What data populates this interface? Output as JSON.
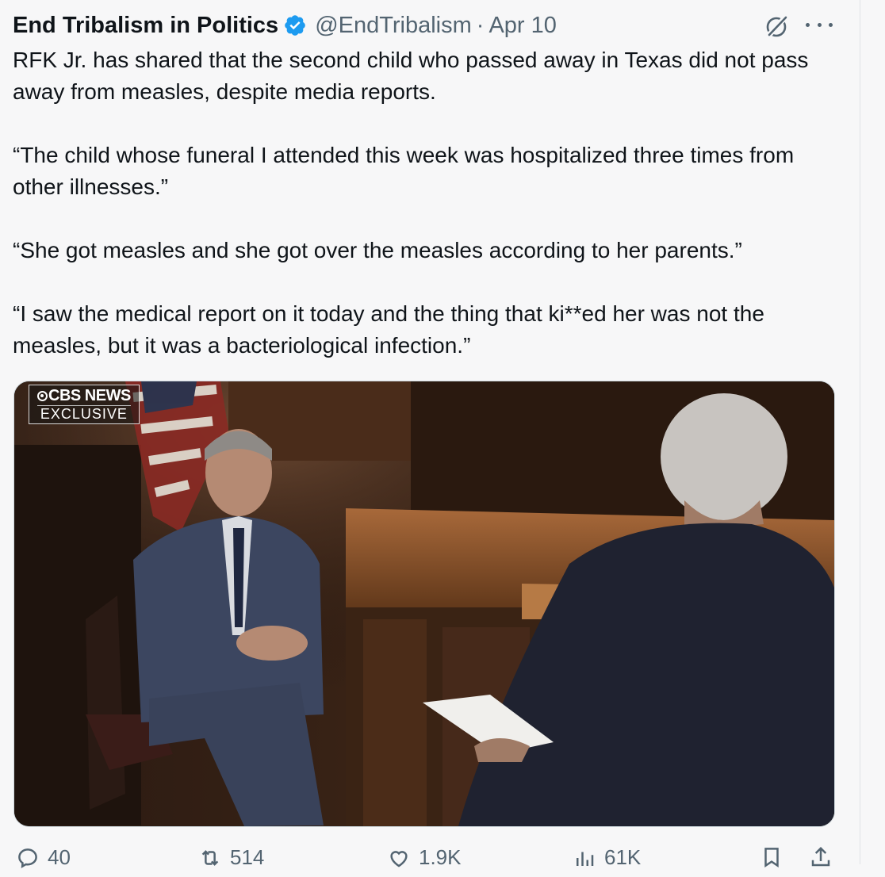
{
  "tweet": {
    "author_name": "End Tribalism in Politics",
    "handle": "@EndTribalism",
    "separator": "·",
    "date": "Apr 10",
    "paragraphs": [
      "RFK Jr. has shared that the second child who passed away in Texas did not pass away from measles, despite media reports.",
      "“The child whose funeral I attended this week was hospitalized three times from other illnesses.”",
      "“She got measles and she got over the measles according to her parents.”",
      "“I saw the medical report on it today and the thing that ki**ed her was not the measles, but it was a bacteriological infection.”"
    ],
    "media": {
      "badge_line1": "CBS NEWS",
      "badge_line2": "EXCLUSIVE"
    },
    "actions": {
      "replies": "40",
      "reposts": "514",
      "likes": "1.9K",
      "views": "61K"
    }
  },
  "colors": {
    "text": "#0f1419",
    "secondary": "#536471",
    "verified": "#1d9bf0",
    "background": "#f7f7f8"
  },
  "icons": [
    "verified-badge-icon",
    "grok-icon",
    "more-icon",
    "reply-icon",
    "repost-icon",
    "like-icon",
    "views-icon",
    "bookmark-icon",
    "share-icon"
  ]
}
